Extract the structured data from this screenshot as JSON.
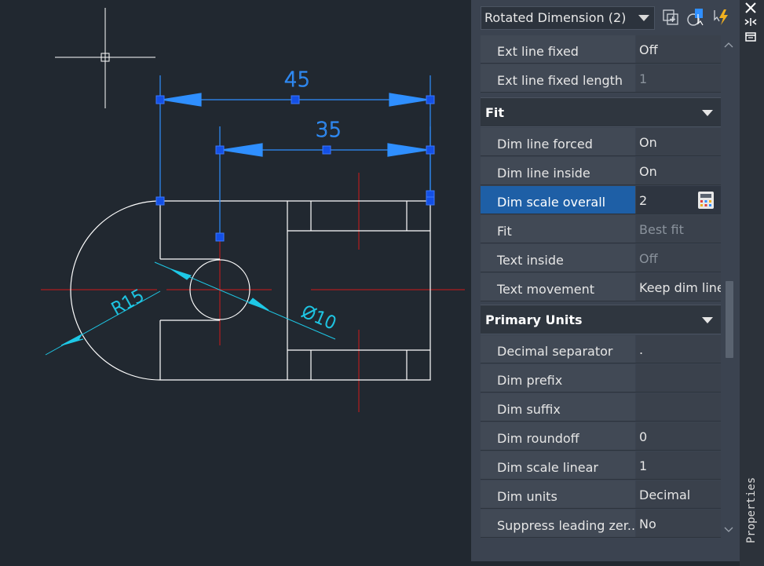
{
  "toolbar": {
    "selection_label": "Rotated Dimension (2)",
    "icons": [
      "add-to-selection-icon",
      "select-objects-icon",
      "quick-select-icon"
    ]
  },
  "drawing": {
    "dim_top": "45",
    "dim_inner": "35",
    "dim_radius": "R15",
    "dim_diameter": "Ø10",
    "colors": {
      "background": "#212830",
      "geometry": "#ffffff",
      "dimension": "#2f8fff",
      "centerline": "#d11a1a",
      "annotation": "#1ec8e6",
      "grip": "#1450e6"
    }
  },
  "properties": {
    "rows_top": [
      {
        "label": "Ext line fixed",
        "value": "Off",
        "dim": false
      },
      {
        "label": "Ext line fixed length",
        "value": "1",
        "dim": true
      }
    ],
    "fit": {
      "title": "Fit",
      "rows": [
        {
          "label": "Dim line forced",
          "value": "On",
          "dim": false
        },
        {
          "label": "Dim line inside",
          "value": "On",
          "dim": false
        },
        {
          "label": "Dim scale overall",
          "value": "2",
          "dim": false
        },
        {
          "label": "Fit",
          "value": "Best fit",
          "dim": true
        },
        {
          "label": "Text inside",
          "value": "Off",
          "dim": true
        },
        {
          "label": "Text movement",
          "value": "Keep dim line",
          "dim": false
        }
      ]
    },
    "primary_units": {
      "title": "Primary Units",
      "rows": [
        {
          "label": "Decimal separator",
          "value": ".",
          "dim": false
        },
        {
          "label": "Dim prefix",
          "value": "",
          "dim": false
        },
        {
          "label": "Dim suffix",
          "value": "",
          "dim": false
        },
        {
          "label": "Dim roundoff",
          "value": "0",
          "dim": false
        },
        {
          "label": "Dim scale linear",
          "value": "1",
          "dim": false
        },
        {
          "label": "Dim units",
          "value": "Decimal",
          "dim": false
        },
        {
          "label": "Suppress leading zer...",
          "value": "No",
          "dim": false
        }
      ]
    }
  },
  "sidebar": {
    "title": "Properties",
    "icons": [
      "close-icon",
      "auto-hide-icon",
      "properties-panel-icon"
    ]
  }
}
